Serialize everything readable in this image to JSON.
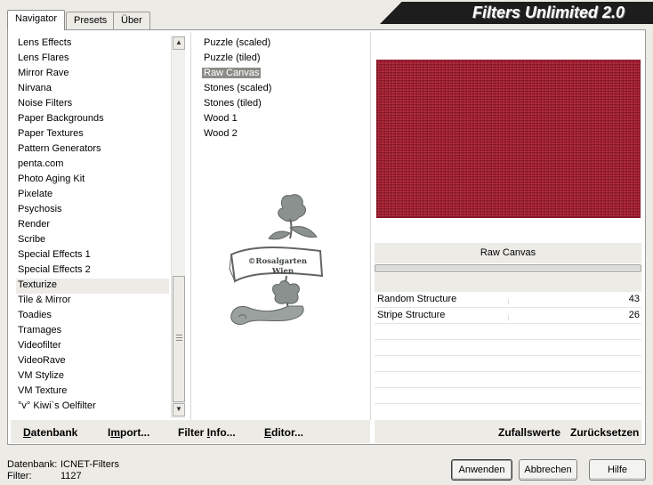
{
  "app": {
    "title": "Filters Unlimited 2.0"
  },
  "tabs": [
    {
      "label": "Navigator",
      "active": true
    },
    {
      "label": "Presets",
      "active": false
    },
    {
      "label": "Über",
      "active": false
    }
  ],
  "categories": {
    "items": [
      "Lens Effects",
      "Lens Flares",
      "Mirror Rave",
      "Nirvana",
      "Noise Filters",
      "Paper Backgrounds",
      "Paper Textures",
      "Pattern Generators",
      "penta.com",
      "Photo Aging Kit",
      "Pixelate",
      "Psychosis",
      "Render",
      "Scribe",
      "Special Effects 1",
      "Special Effects 2",
      "Texturize",
      "Tile & Mirror",
      "Toadies",
      "Tramages",
      "Videofilter",
      "VideoRave",
      "VM Stylize",
      "VM Texture",
      "°v° Kiwi`s Oelfilter"
    ],
    "selected": "Texturize"
  },
  "filters": {
    "items": [
      "Puzzle (scaled)",
      "Puzzle (tiled)",
      "Raw Canvas",
      "Stones (scaled)",
      "Stones (tiled)",
      "Wood 1",
      "Wood 2"
    ],
    "selected": "Raw Canvas"
  },
  "watermark": {
    "line1": "©Rosalgarten",
    "line2": "Wien"
  },
  "preview": {
    "color": "#a91e31"
  },
  "selected_filter_name": "Raw Canvas",
  "params": [
    {
      "name": "Random Structure",
      "value": "43"
    },
    {
      "name": "Stripe Structure",
      "value": "26"
    }
  ],
  "toolbar_left": {
    "datenbank": {
      "u": "D",
      "rest": "atenbank"
    },
    "import": {
      "pre": "I",
      "u": "m",
      "rest": "port..."
    },
    "filter_info": {
      "pre": "Filter ",
      "u": "I",
      "rest": "nfo..."
    },
    "editor": {
      "u": "E",
      "rest": "ditor..."
    }
  },
  "toolbar_right": {
    "zufallswerte": "Zufallswerte",
    "zuruecksetzen": "Zurücksetzen"
  },
  "status": {
    "db_label": "Datenbank:",
    "db_value": "ICNET-Filters",
    "filter_label": "Filter:",
    "filter_value": "1127"
  },
  "buttons": {
    "apply": "Anwenden",
    "cancel": "Abbrechen",
    "help": "Hilfe"
  }
}
